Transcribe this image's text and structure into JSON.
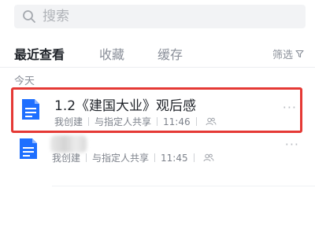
{
  "search": {
    "placeholder": "搜索",
    "icon": "search-icon"
  },
  "tabs": [
    {
      "label": "最近查看",
      "active": true
    },
    {
      "label": "收藏",
      "active": false
    },
    {
      "label": "缓存",
      "active": false
    }
  ],
  "filter": {
    "label": "筛选",
    "icon": "filter-icon"
  },
  "section_label": "今天",
  "documents": [
    {
      "title": "1.2《建国大业》观后感",
      "creator": "我创建",
      "share": "与指定人共享",
      "time": "11:46",
      "icon": "doc-icon",
      "highlighted": true
    },
    {
      "title": "",
      "creator": "我创建",
      "share": "与指定人共享",
      "time": "11:45",
      "icon": "doc-icon",
      "highlighted": false
    }
  ],
  "more_label": "···",
  "colors": {
    "accent": "#1e6fff",
    "highlight": "#e53935",
    "muted": "#8a8f99"
  }
}
